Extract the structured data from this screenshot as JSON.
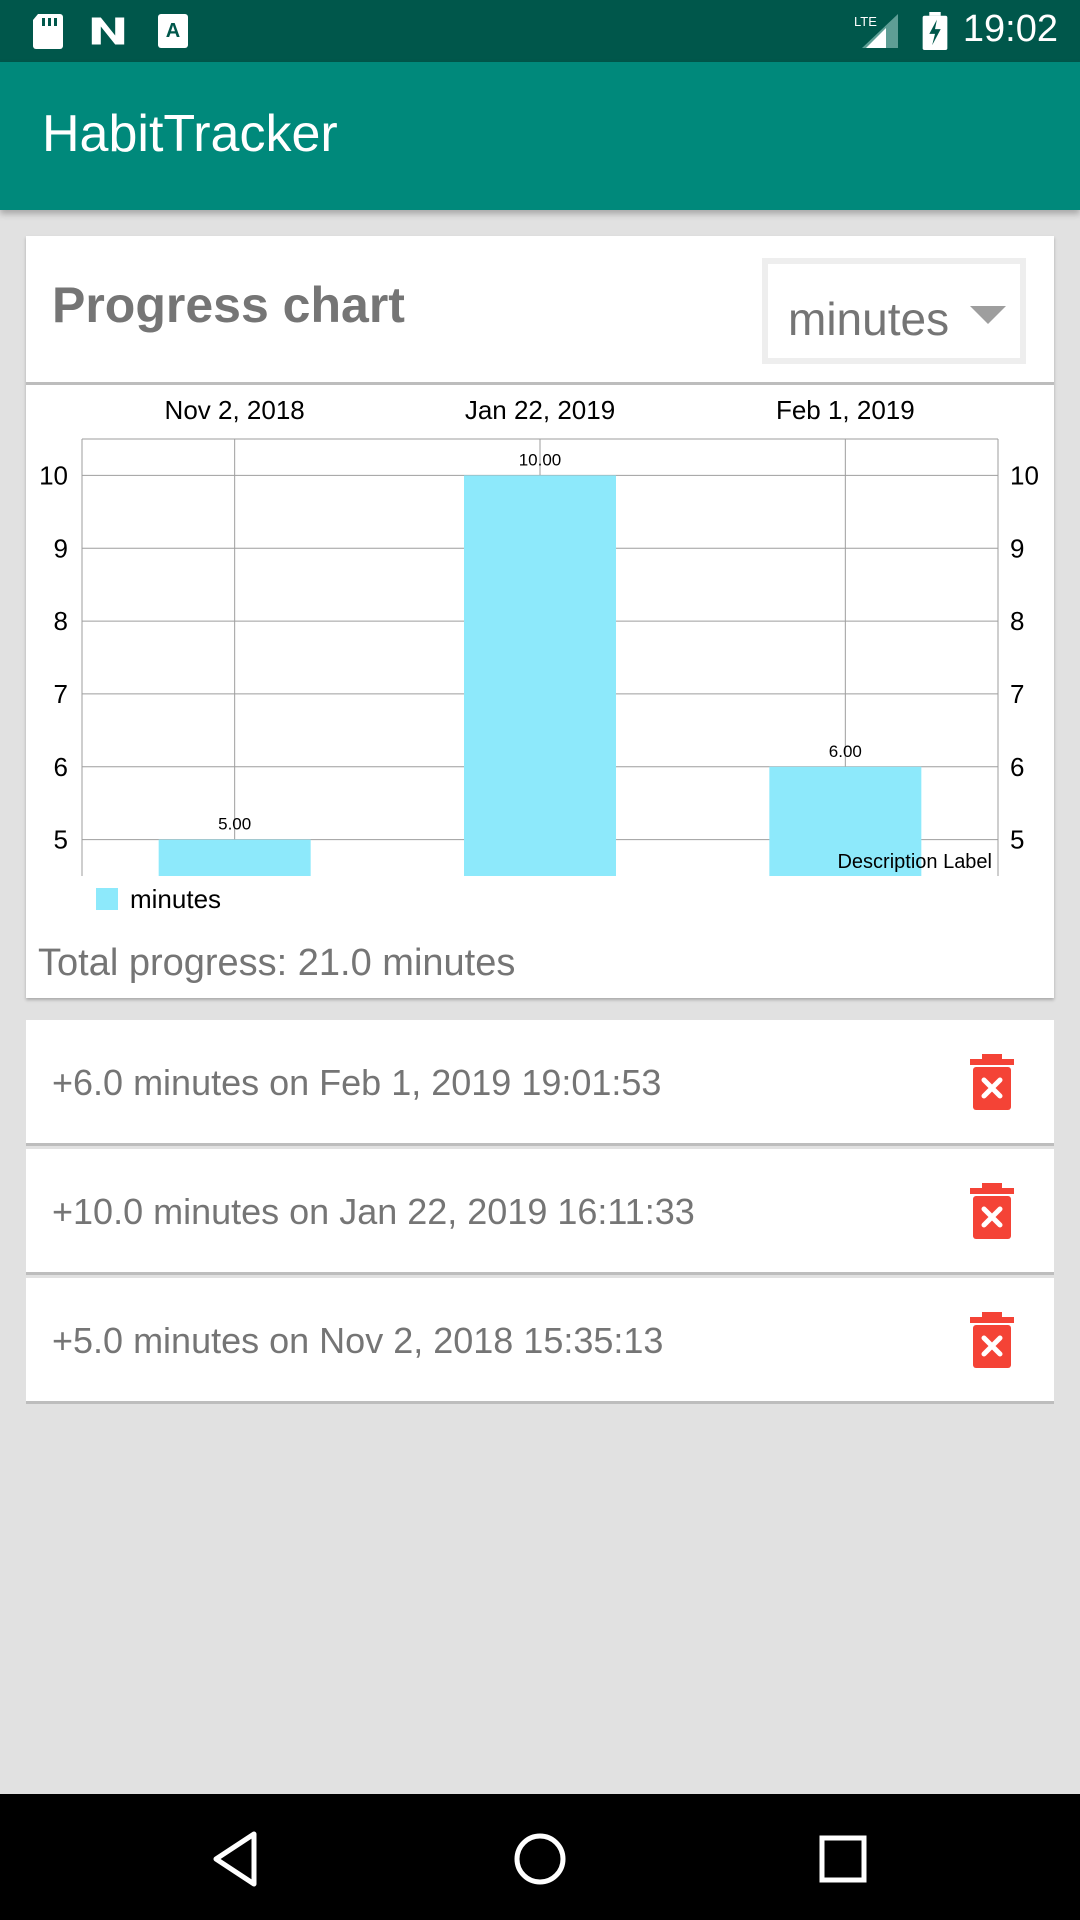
{
  "status_bar": {
    "time": "19:02",
    "network": "LTE",
    "icons": [
      "sd-card-icon",
      "n-notification-icon",
      "a-notification-icon",
      "lte-signal-icon",
      "battery-charging-icon"
    ]
  },
  "app_bar": {
    "title": "HabitTracker"
  },
  "chart_card": {
    "title": "Progress chart",
    "unit_dropdown": {
      "selected": "minutes"
    },
    "total": "Total progress: 21.0 minutes"
  },
  "chart_data": {
    "type": "bar",
    "categories": [
      "Nov 2, 2018",
      "Jan 22, 2019",
      "Feb 1, 2019"
    ],
    "values": [
      5.0,
      10.0,
      6.0
    ],
    "data_labels": [
      "5.00",
      "10.00",
      "6.00"
    ],
    "series": [
      {
        "name": "minutes",
        "values": [
          5.0,
          10.0,
          6.0
        ],
        "color": "#8de9fb"
      }
    ],
    "y_ticks": [
      "5",
      "6",
      "7",
      "8",
      "9",
      "10"
    ],
    "ylim": [
      4.5,
      10.5
    ],
    "description": "Description Label",
    "grid": true,
    "legend": "bottom-left",
    "x_axis_position": "top",
    "dual_y_axis": true
  },
  "entries": [
    {
      "text": "+6.0 minutes on Feb 1, 2019 19:01:53"
    },
    {
      "text": "+10.0 minutes on Jan 22, 2019 16:11:33"
    },
    {
      "text": "+5.0 minutes on Nov 2, 2018 15:35:13"
    }
  ],
  "colors": {
    "status_bar": "#00574b",
    "app_bar": "#00897b",
    "bar": "#8de9fb",
    "delete": "#f44336",
    "secondary_text": "#757575"
  },
  "nav_bar": {
    "buttons": [
      "back-icon",
      "home-icon",
      "recents-icon"
    ]
  }
}
